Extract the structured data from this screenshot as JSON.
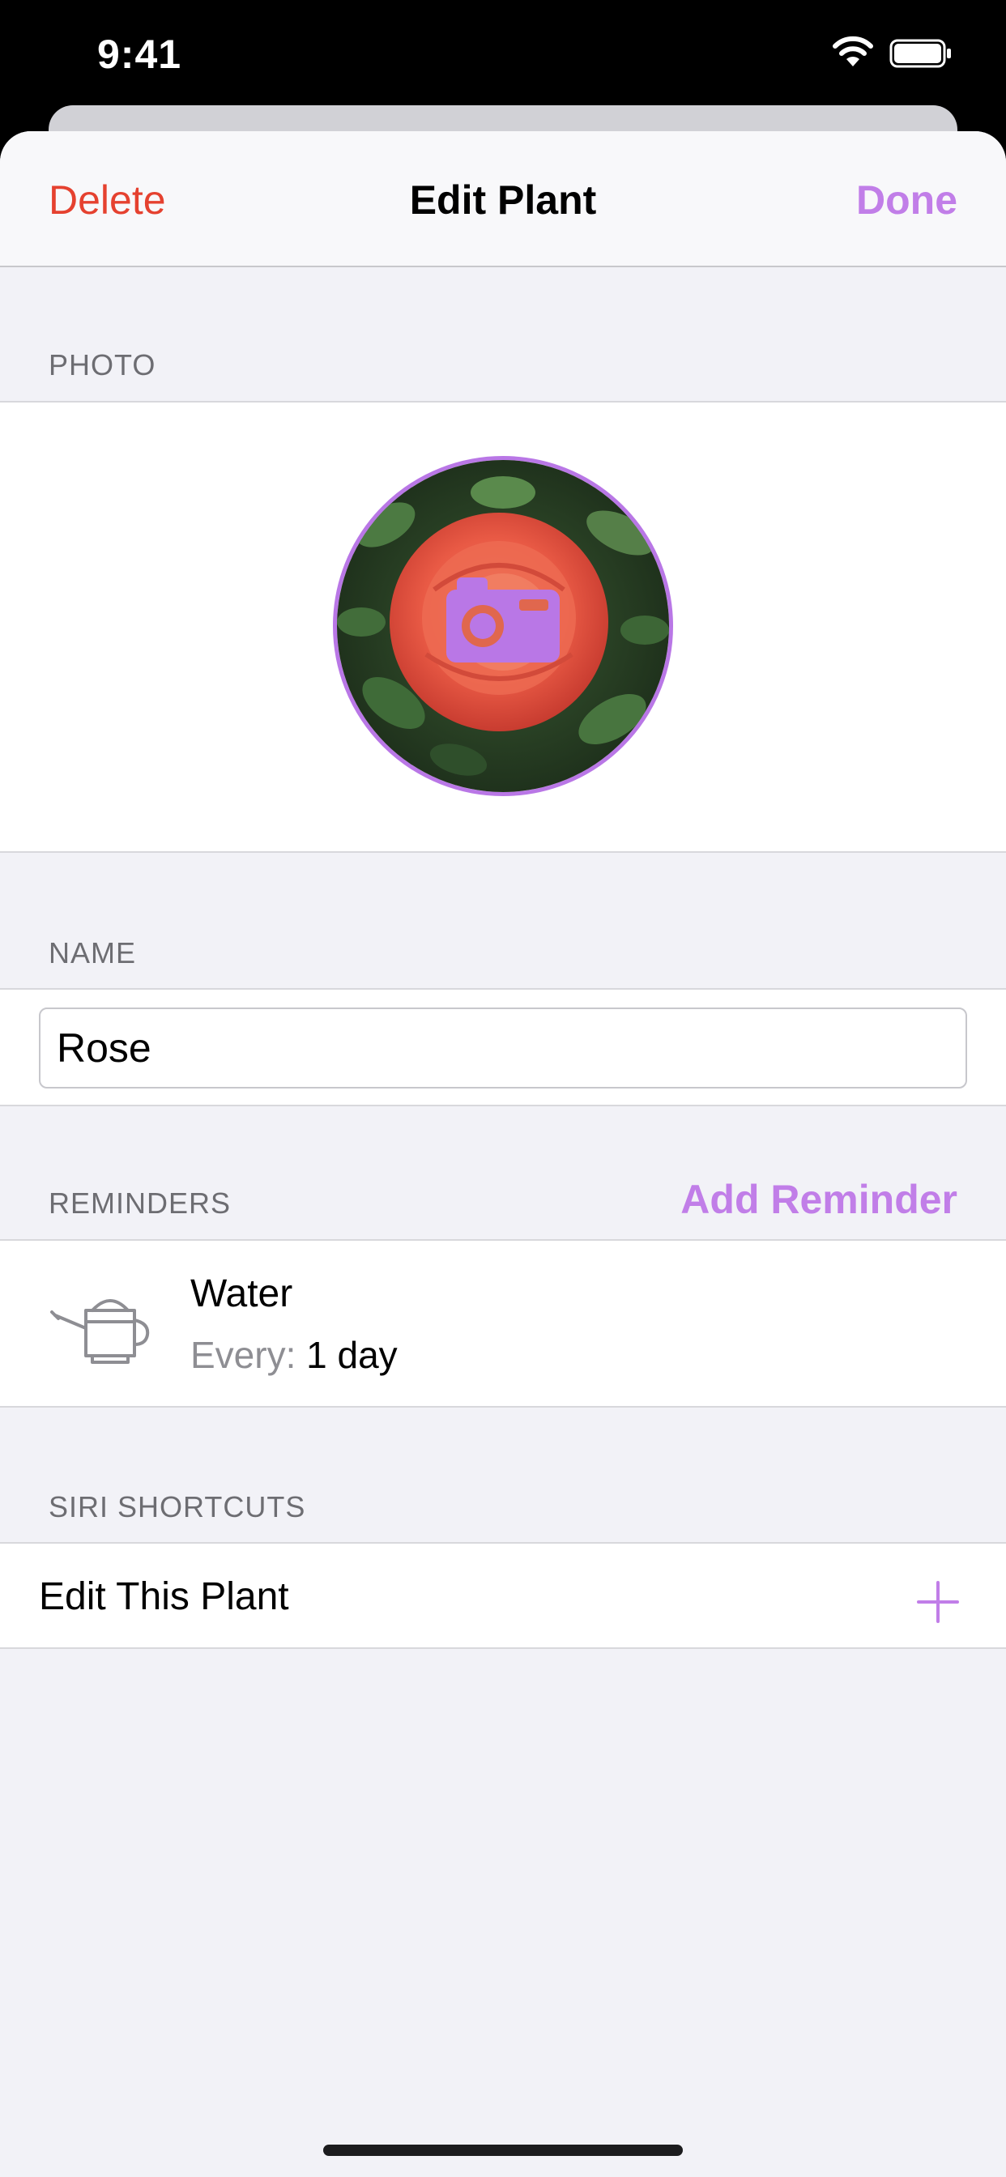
{
  "status_bar": {
    "time": "9:41"
  },
  "nav": {
    "left_label": "Delete",
    "title": "Edit Plant",
    "right_label": "Done"
  },
  "photo": {
    "header": "PHOTO",
    "camera_icon": "camera-icon"
  },
  "name": {
    "header": "NAME",
    "value": "Rose"
  },
  "reminders": {
    "header": "REMINDERS",
    "add_label": "Add Reminder",
    "items": [
      {
        "icon": "watering-can-icon",
        "title": "Water",
        "every_label": "Every:",
        "interval": "1 day"
      }
    ]
  },
  "siri": {
    "header": "SIRI SHORTCUTS",
    "item_label": "Edit This Plant"
  },
  "colors": {
    "accent": "#c17ee8",
    "destructive": "#e5412f",
    "background": "#f2f2f7"
  }
}
